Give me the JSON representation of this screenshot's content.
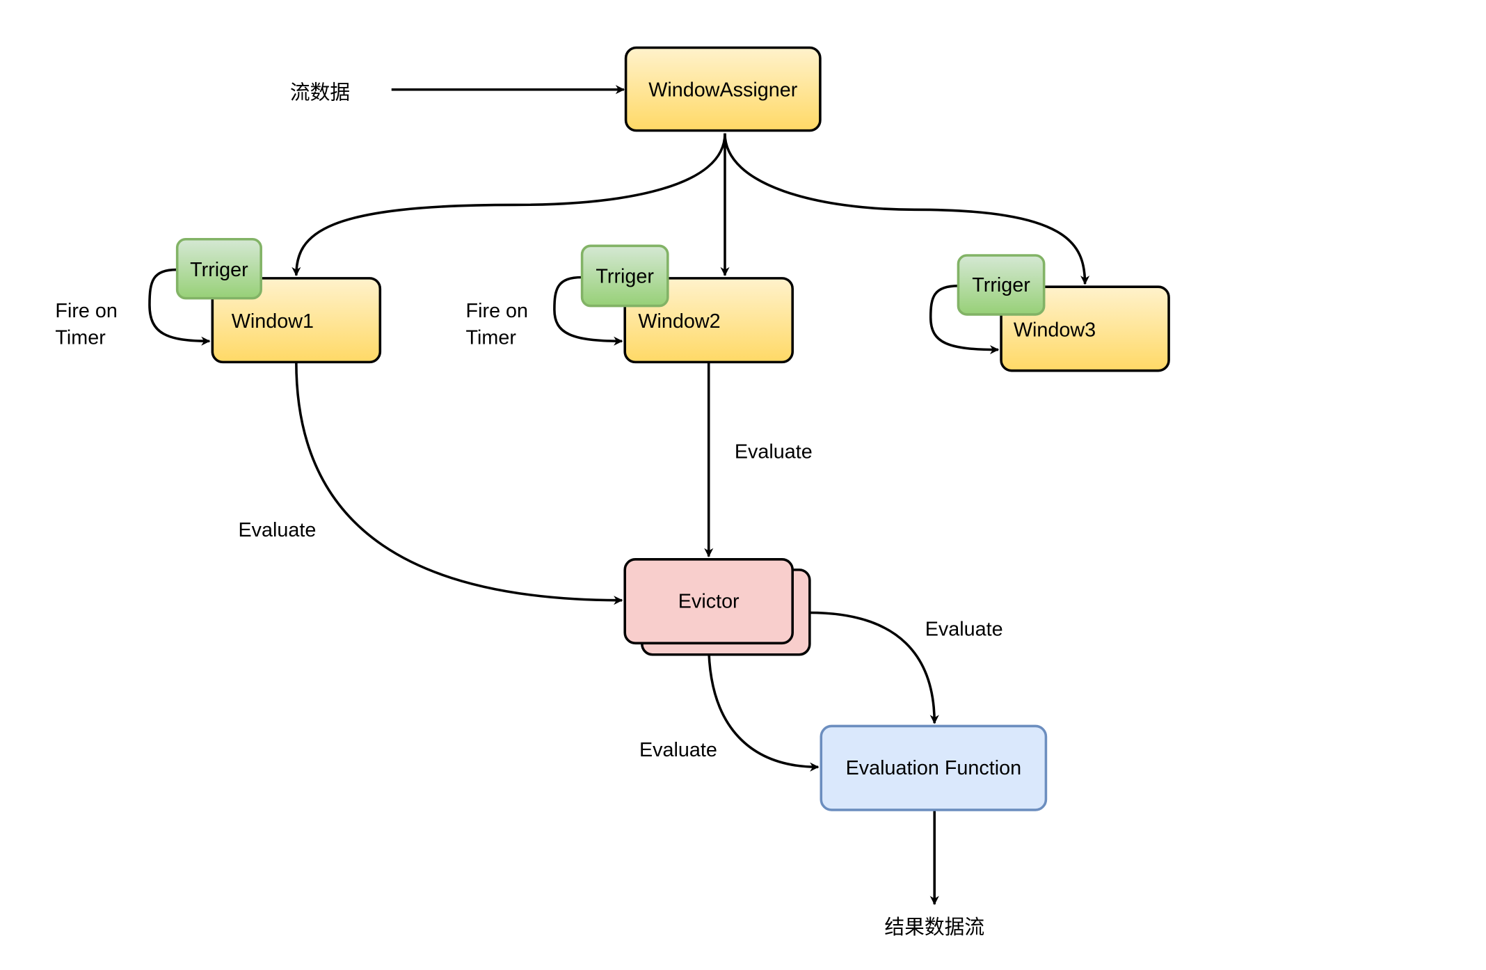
{
  "input_label": "流数据",
  "output_label": "结果数据流",
  "nodes": {
    "window_assigner": "WindowAssigner",
    "window1": "Window1",
    "window2": "Window2",
    "window3": "Window3",
    "trigger1": "Trriger",
    "trigger2": "Trriger",
    "trigger3": "Trriger",
    "evictor": "Evictor",
    "evaluation_function": "Evaluation Function"
  },
  "edge_labels": {
    "fire_on_timer_1": [
      "Fire on",
      "Timer"
    ],
    "fire_on_timer_2": [
      "Fire on",
      "Timer"
    ],
    "evaluate_window1": "Evaluate",
    "evaluate_window2": "Evaluate",
    "evaluate_evictor_right": "Evaluate",
    "evaluate_evictor_bottom": "Evaluate"
  },
  "colors": {
    "window_fill_top": "#fff2cc",
    "window_fill_bottom": "#ffd966",
    "trigger_fill_top": "#d5e8d4",
    "trigger_fill_bottom": "#97d077",
    "trigger_stroke": "#82b366",
    "evictor_fill": "#f8cecc",
    "function_fill": "#dae8fc",
    "function_stroke": "#6c8ebf"
  }
}
